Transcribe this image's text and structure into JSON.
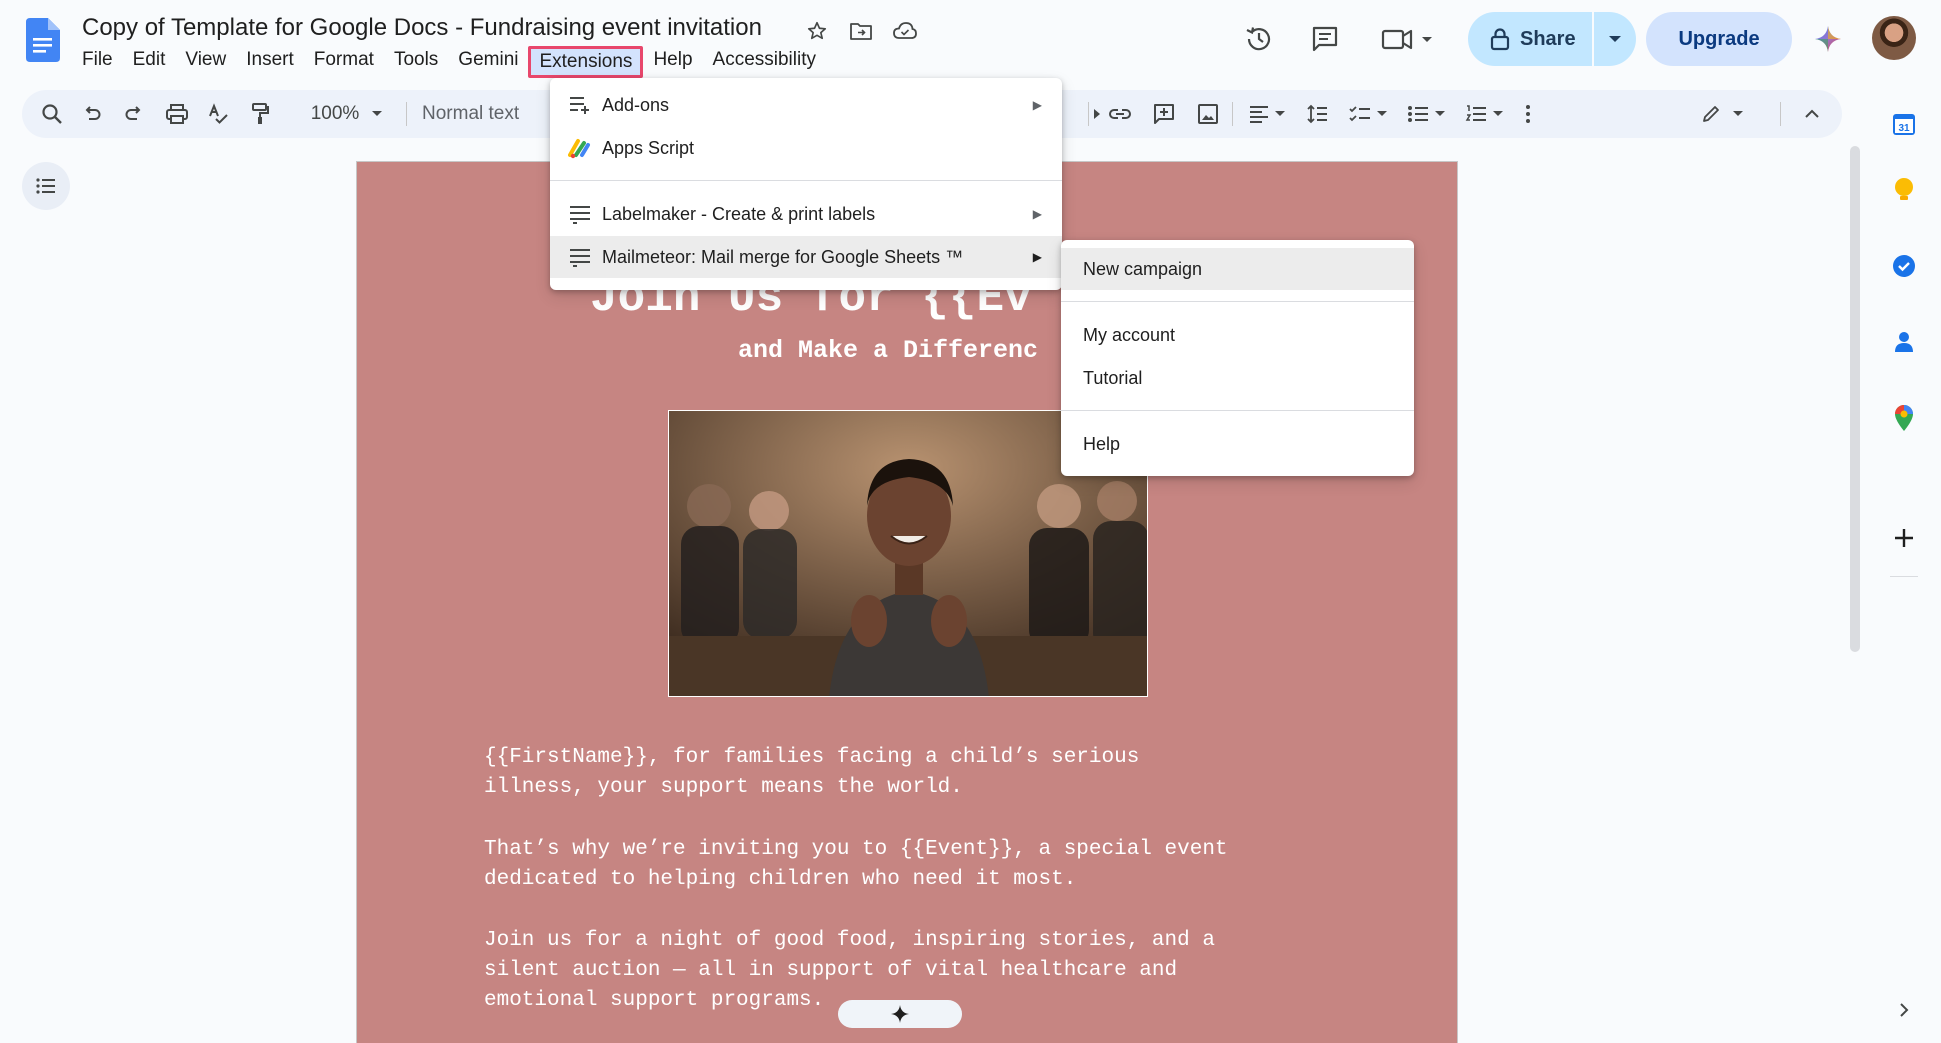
{
  "header": {
    "title": "Copy of Template for Google Docs - Fundraising event invitation",
    "icons": [
      "star-icon",
      "move-folder-icon",
      "cloud-saved-icon"
    ],
    "menus": [
      "File",
      "Edit",
      "View",
      "Insert",
      "Format",
      "Tools",
      "Gemini",
      "Extensions",
      "Help",
      "Accessibility"
    ],
    "active_menu": "Extensions",
    "share_label": "Share",
    "upgrade_label": "Upgrade"
  },
  "toolbar": {
    "zoom": "100%",
    "style": "Normal text"
  },
  "extensions_menu": {
    "items": [
      {
        "label": "Add-ons",
        "icon": "addons-icon",
        "submenu": true
      },
      {
        "label": "Apps Script",
        "icon": "apps-script-icon",
        "submenu": false
      },
      {
        "label": "Labelmaker - Create & print labels",
        "icon": "addon-list-icon",
        "submenu": true
      },
      {
        "label": "Mailmeteor: Mail merge for Google Sheets ™",
        "icon": "addon-list-icon",
        "submenu": true
      }
    ]
  },
  "mailmeteor_submenu": {
    "items": [
      {
        "label": "New campaign"
      },
      {
        "label": "My account"
      },
      {
        "label": "Tutorial"
      },
      {
        "label": "Help"
      }
    ]
  },
  "document": {
    "heading": "Join Us for {{Ev",
    "subheading": "and Make a Differenc",
    "paragraphs": [
      "{{FirstName}}, for families facing a child’s serious\nillness, your support means the world.",
      "That’s why we’re inviting you to {{Event}}, a special event\ndedicated to helping children who need it most.",
      "Join us for a night of good food, inspiring stories, and a\nsilent auction — all in support of vital healthcare and\nemotional support programs."
    ]
  },
  "side_panel": {
    "icons": [
      "calendar-icon",
      "keep-icon",
      "tasks-icon",
      "contacts-icon",
      "maps-icon",
      "add-icon"
    ],
    "calendar_day": "31"
  },
  "colors": {
    "page_background": "#c68582",
    "highlight_border": "#e8476c",
    "share_bg": "#c2e7ff",
    "upgrade_bg": "#d3e3fd"
  }
}
